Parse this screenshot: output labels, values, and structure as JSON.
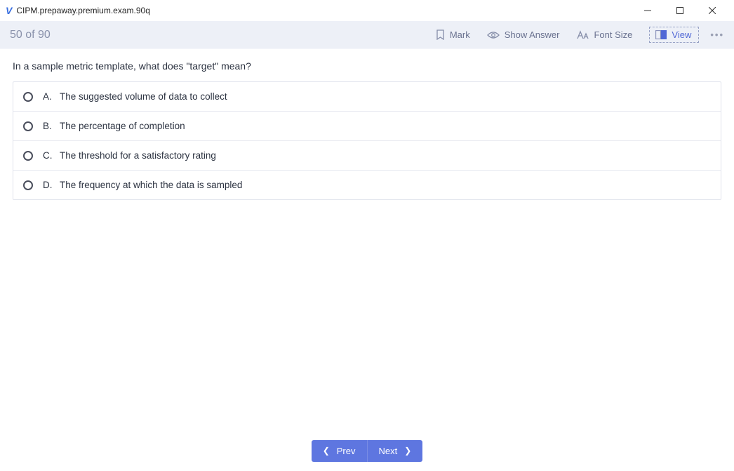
{
  "window": {
    "title": "CIPM.prepaway.premium.exam.90q"
  },
  "toolbar": {
    "counter": "50 of 90",
    "mark_label": "Mark",
    "show_answer_label": "Show Answer",
    "font_size_label": "Font Size",
    "view_label": "View",
    "more_label": "•••"
  },
  "question": {
    "text": "In a sample metric template, what does \"target\" mean?",
    "options": [
      {
        "letter": "A.",
        "text": "The suggested volume of data to collect"
      },
      {
        "letter": "B.",
        "text": "The percentage of completion"
      },
      {
        "letter": "C.",
        "text": "The threshold for a satisfactory rating"
      },
      {
        "letter": "D.",
        "text": "The frequency at which the data is sampled"
      }
    ]
  },
  "footer": {
    "prev_label": "Prev",
    "next_label": "Next"
  }
}
